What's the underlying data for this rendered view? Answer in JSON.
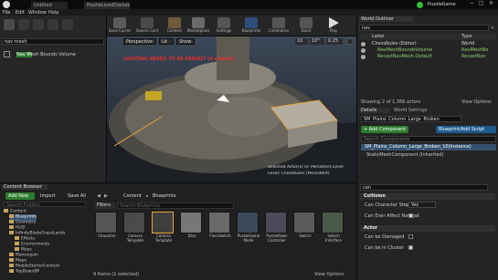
{
  "window": {
    "title": "PuzzleGame",
    "tab_label": "Untitled",
    "tab2_label": "PuzzleLevelDashed"
  },
  "menu": [
    "File",
    "Edit",
    "Window",
    "Help"
  ],
  "toolbar": {
    "buttons": [
      "Save Current",
      "Source Control",
      "Content",
      "Marketplace",
      "Settings",
      "Blueprints",
      "Cinematics",
      "Build",
      "Play"
    ]
  },
  "modes": {
    "search_value": "nav mesh",
    "result_label": "Nav Mesh Bounds Volume",
    "result_highlight": "Nav Mesh"
  },
  "viewport": {
    "mode_label": "Perspective",
    "lit_label": "Lit",
    "show_label": "Show",
    "grid_value": "10",
    "rot_value": "10°",
    "scale_value": "0.25",
    "warning_text": "LIGHTING NEEDS TO BE REBUILT (4 unbuilt)",
    "selected_text": "Selected Actor(s) in: Persistent Level",
    "level_text": "Level: ChessRules (Persistent)"
  },
  "outliner": {
    "panel_title": "World Outliner",
    "search_value": "nav",
    "col_label": "Label",
    "col_type": "Type",
    "rows": [
      {
        "label": "ChessRules (Editor)",
        "type": "World"
      },
      {
        "label": "NavMeshBoundsVolume",
        "type": "NavMeshBo"
      },
      {
        "label": "RecastNavMesh-Default",
        "type": "RecastNav"
      }
    ],
    "status": "Showing 2 of 1,366 actors",
    "view_options": "View Options"
  },
  "details": {
    "tab1": "Details",
    "tab2": "World Settings",
    "name_value": "SM_Plains_Column_Large_Broken",
    "add_component": "+ Add Component",
    "blueprint_script": "Blueprint/Add Script",
    "search_placeholder": "Search Components",
    "component_root": "SM_Plains_Column_Large_Broken_10(Instance)",
    "component_child": "StaticMeshComponent (Inherited)"
  },
  "props": {
    "search_value": "can",
    "section_collision": "Collision",
    "can_step_label": "Can Character Step Up On",
    "can_step_value": "Yes",
    "can_affect_label": "Can Ever Affect Navigation",
    "section_actor": "Actor",
    "can_damaged_label": "Can be Damaged",
    "can_cluster_label": "Can be in Cluster"
  },
  "content_browser": {
    "panel_title": "Content Browser",
    "add_new": "Add New",
    "import": "Import",
    "save_all": "Save All",
    "filters": "Filters",
    "search_placeholder": "Search Blueprints",
    "crumb_content": "Content",
    "crumb_blueprints": "Blueprints",
    "tree_search_placeholder": "Search Folders",
    "tree": [
      {
        "label": "Content",
        "depth": 0
      },
      {
        "label": "Blueprints",
        "depth": 1
      },
      {
        "label": "Geometry",
        "depth": 1
      },
      {
        "label": "HUD",
        "depth": 1
      },
      {
        "label": "InfinityBladeGrassLands",
        "depth": 1
      },
      {
        "label": "Effects",
        "depth": 2
      },
      {
        "label": "Environments",
        "depth": 2
      },
      {
        "label": "Maps",
        "depth": 2
      },
      {
        "label": "Mannequin",
        "depth": 1
      },
      {
        "label": "Maps",
        "depth": 1
      },
      {
        "label": "MobileStarterContent",
        "depth": 1
      },
      {
        "label": "TopDownBP",
        "depth": 1
      }
    ],
    "assets": [
      "Character",
      "Camera Template",
      "Camera Template",
      "Dice",
      "FloorSwitch",
      "PuzzleGame Mode",
      "PuzzlePawn Controller",
      "Switch",
      "Switch Interface"
    ],
    "status": "9 items (1 selected)",
    "view_options": "View Options"
  },
  "colors": {
    "accent_blue": "#1d5b8f",
    "accent_green": "#2f7d2f",
    "warning_red": "#e03030",
    "selection_orange": "#e8a33a"
  }
}
